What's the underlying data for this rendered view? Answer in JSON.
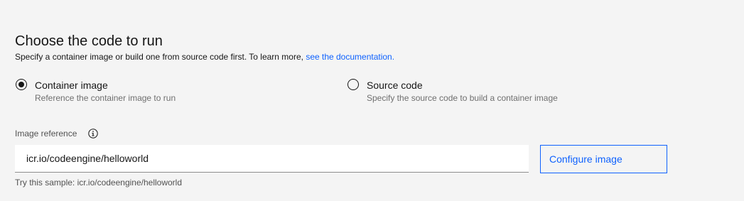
{
  "section": {
    "title": "Choose the code to run",
    "description": "Specify a container image or build one from source code first. To learn more, ",
    "doc_link_text": "see the documentation."
  },
  "options": [
    {
      "label": "Container image",
      "description": "Reference the container image to run",
      "selected": true
    },
    {
      "label": "Source code",
      "description": "Specify the source code to build a container image",
      "selected": false
    }
  ],
  "image_field": {
    "label": "Image reference",
    "info_icon": "info-icon",
    "value": "icr.io/codeengine/helloworld",
    "helper": "Try this sample: icr.io/codeengine/helloworld"
  },
  "configure_button": {
    "label": "Configure image"
  },
  "colors": {
    "link": "#0f62fe",
    "background": "#f4f4f4"
  }
}
